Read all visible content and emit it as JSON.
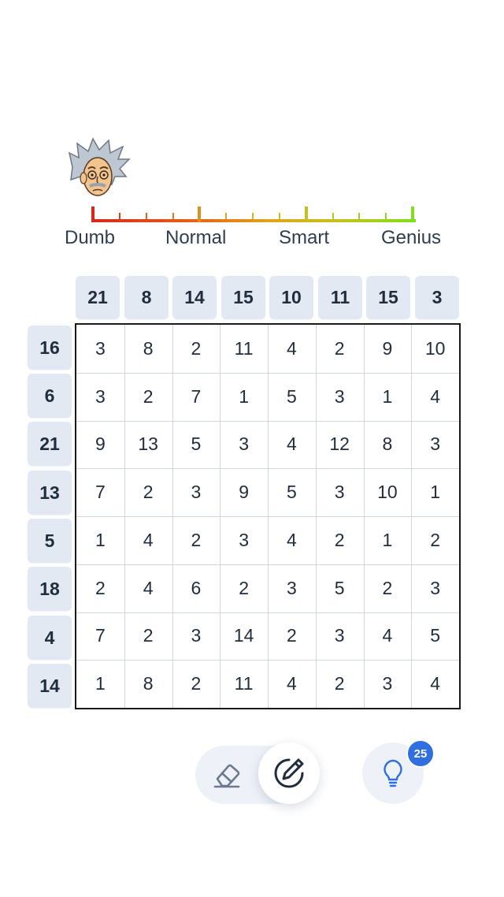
{
  "avatar": {
    "icon": "einstein-avatar-icon"
  },
  "meter": {
    "labels": {
      "dumb": "Dumb",
      "normal": "Normal",
      "smart": "Smart",
      "genius": "Genius"
    },
    "level": 0.0,
    "colors": {
      "start": "#d9271a",
      "mid": "#e0a51a",
      "end": "#7ee01a"
    }
  },
  "puzzle": {
    "column_clues": [
      "21",
      "8",
      "14",
      "15",
      "10",
      "11",
      "15",
      "3"
    ],
    "row_clues": [
      "16",
      "6",
      "21",
      "13",
      "5",
      "18",
      "4",
      "14"
    ],
    "grid": [
      [
        "3",
        "8",
        "2",
        "11",
        "4",
        "2",
        "9",
        "10"
      ],
      [
        "3",
        "2",
        "7",
        "1",
        "5",
        "3",
        "1",
        "4"
      ],
      [
        "9",
        "13",
        "5",
        "3",
        "4",
        "12",
        "8",
        "3"
      ],
      [
        "7",
        "2",
        "3",
        "9",
        "5",
        "3",
        "10",
        "1"
      ],
      [
        "1",
        "4",
        "2",
        "3",
        "4",
        "2",
        "1",
        "2"
      ],
      [
        "2",
        "4",
        "6",
        "2",
        "3",
        "5",
        "2",
        "3"
      ],
      [
        "7",
        "2",
        "3",
        "14",
        "2",
        "3",
        "4",
        "5"
      ],
      [
        "1",
        "8",
        "2",
        "11",
        "4",
        "2",
        "3",
        "4"
      ]
    ]
  },
  "toolbar": {
    "eraser_icon": "eraser-icon",
    "pencil_icon": "pencil-icon",
    "hint_icon": "lightbulb-icon",
    "hint_count": "25",
    "accent": "#2f6fe0"
  }
}
